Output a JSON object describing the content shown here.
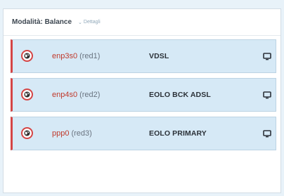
{
  "header": {
    "mode_label": "Modalità: Balance",
    "details_label": "Dettagli"
  },
  "interfaces": [
    {
      "name": "enp3s0",
      "zone": "(red1)",
      "provider": "VDSL"
    },
    {
      "name": "enp4s0",
      "zone": "(red2)",
      "provider": "EOLO BCK ADSL"
    },
    {
      "name": "ppp0",
      "zone": "(red3)",
      "provider": "EOLO PRIMARY"
    }
  ],
  "icons": {
    "row_status": "globe-icon",
    "row_action": "monitor-icon",
    "details": "chevron-down-icon"
  },
  "colors": {
    "accent_red": "#d44545",
    "row_background": "#d6e9f6",
    "page_background": "#e8f2f9"
  }
}
